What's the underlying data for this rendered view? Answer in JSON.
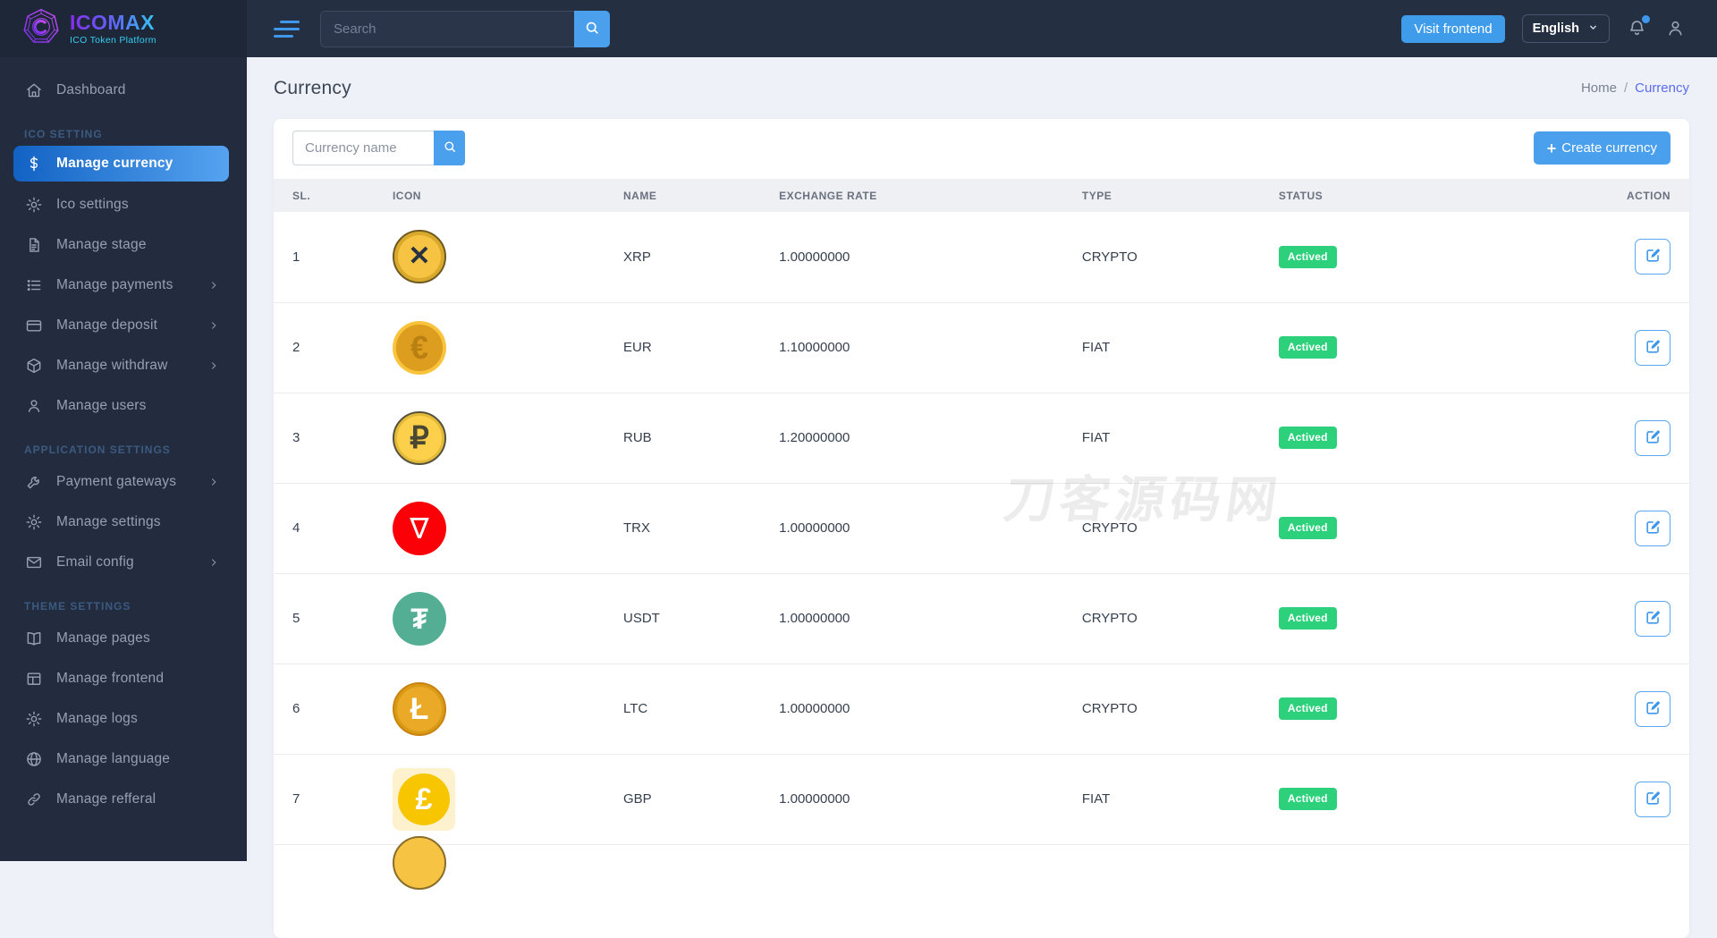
{
  "brand": {
    "name": "ICOMAX",
    "tagline": "ICO Token Platform"
  },
  "topbar": {
    "search_placeholder": "Search",
    "visit_frontend_label": "Visit frontend",
    "language_selected": "English",
    "icons": [
      "bell-icon",
      "user-icon"
    ]
  },
  "sidebar": {
    "sections": [
      {
        "header": "",
        "items": [
          {
            "label": "Dashboard",
            "icon": "home-icon",
            "active": false,
            "chevron": false
          }
        ]
      },
      {
        "header": "ICO SETTING",
        "items": [
          {
            "label": "Manage currency",
            "icon": "dollar-icon",
            "active": true,
            "chevron": false
          },
          {
            "label": "Ico settings",
            "icon": "gear-icon",
            "active": false,
            "chevron": false
          },
          {
            "label": "Manage stage",
            "icon": "file-icon",
            "active": false,
            "chevron": false
          },
          {
            "label": "Manage payments",
            "icon": "list-icon",
            "active": false,
            "chevron": true
          },
          {
            "label": "Manage deposit",
            "icon": "credit-card-icon",
            "active": false,
            "chevron": true
          },
          {
            "label": "Manage withdraw",
            "icon": "package-icon",
            "active": false,
            "chevron": true
          },
          {
            "label": "Manage users",
            "icon": "user-icon",
            "active": false,
            "chevron": false
          }
        ]
      },
      {
        "header": "APPLICATION SETTINGS",
        "items": [
          {
            "label": "Payment gateways",
            "icon": "wrench-icon",
            "active": false,
            "chevron": true
          },
          {
            "label": "Manage settings",
            "icon": "gear-icon",
            "active": false,
            "chevron": false
          },
          {
            "label": "Email config",
            "icon": "mail-icon",
            "active": false,
            "chevron": true
          }
        ]
      },
      {
        "header": "THEME SETTINGS",
        "items": [
          {
            "label": "Manage pages",
            "icon": "book-icon",
            "active": false,
            "chevron": false
          },
          {
            "label": "Manage frontend",
            "icon": "layout-icon",
            "active": false,
            "chevron": false
          },
          {
            "label": "Manage logs",
            "icon": "gear-icon",
            "active": false,
            "chevron": false
          },
          {
            "label": "Manage language",
            "icon": "globe-icon",
            "active": false,
            "chevron": false
          },
          {
            "label": "Manage refferal",
            "icon": "link-icon",
            "active": false,
            "chevron": false
          }
        ]
      }
    ]
  },
  "page": {
    "title": "Currency",
    "breadcrumb": [
      "Home",
      "Currency"
    ]
  },
  "filters": {
    "currency_name_placeholder": "Currency name",
    "create_button_label": "Create currency"
  },
  "table": {
    "headers": [
      "SL.",
      "ICON",
      "NAME",
      "EXCHANGE RATE",
      "TYPE",
      "STATUS",
      "ACTION"
    ],
    "rows": [
      {
        "sl": "1",
        "coin": "xrp",
        "symbol": "✕",
        "name": "XRP",
        "rate": "1.00000000",
        "type": "CRYPTO",
        "status": "Actived",
        "partial": false
      },
      {
        "sl": "2",
        "coin": "eur",
        "symbol": "€",
        "name": "EUR",
        "rate": "1.10000000",
        "type": "FIAT",
        "status": "Actived",
        "partial": false
      },
      {
        "sl": "3",
        "coin": "rub",
        "symbol": "₽",
        "name": "RUB",
        "rate": "1.20000000",
        "type": "FIAT",
        "status": "Actived",
        "partial": false
      },
      {
        "sl": "4",
        "coin": "trx",
        "symbol": "∇",
        "name": "TRX",
        "rate": "1.00000000",
        "type": "CRYPTO",
        "status": "Actived",
        "partial": false
      },
      {
        "sl": "5",
        "coin": "usdt",
        "symbol": "₮",
        "name": "USDT",
        "rate": "1.00000000",
        "type": "CRYPTO",
        "status": "Actived",
        "partial": false
      },
      {
        "sl": "6",
        "coin": "ltc",
        "symbol": "Ł",
        "name": "LTC",
        "rate": "1.00000000",
        "type": "CRYPTO",
        "status": "Actived",
        "partial": false
      },
      {
        "sl": "7",
        "coin": "gbp",
        "symbol": "£",
        "name": "GBP",
        "rate": "1.00000000",
        "type": "FIAT",
        "status": "Actived",
        "partial": false
      },
      {
        "sl": "",
        "coin": "gold",
        "symbol": "",
        "name": "",
        "rate": "",
        "type": "",
        "status": "",
        "partial": true
      }
    ]
  },
  "watermark": "刀客源码网",
  "colors": {
    "accent_blue": "#4aa0ed",
    "active_gradient_start": "#1262c4",
    "active_gradient_end": "#55a3f0",
    "badge_green": "#2dd17c",
    "sidebar_bg": "#222c3e",
    "topbar_bg": "#242f42",
    "content_bg": "#eef1f8",
    "breadcrumb_active": "#5b6cf0"
  }
}
